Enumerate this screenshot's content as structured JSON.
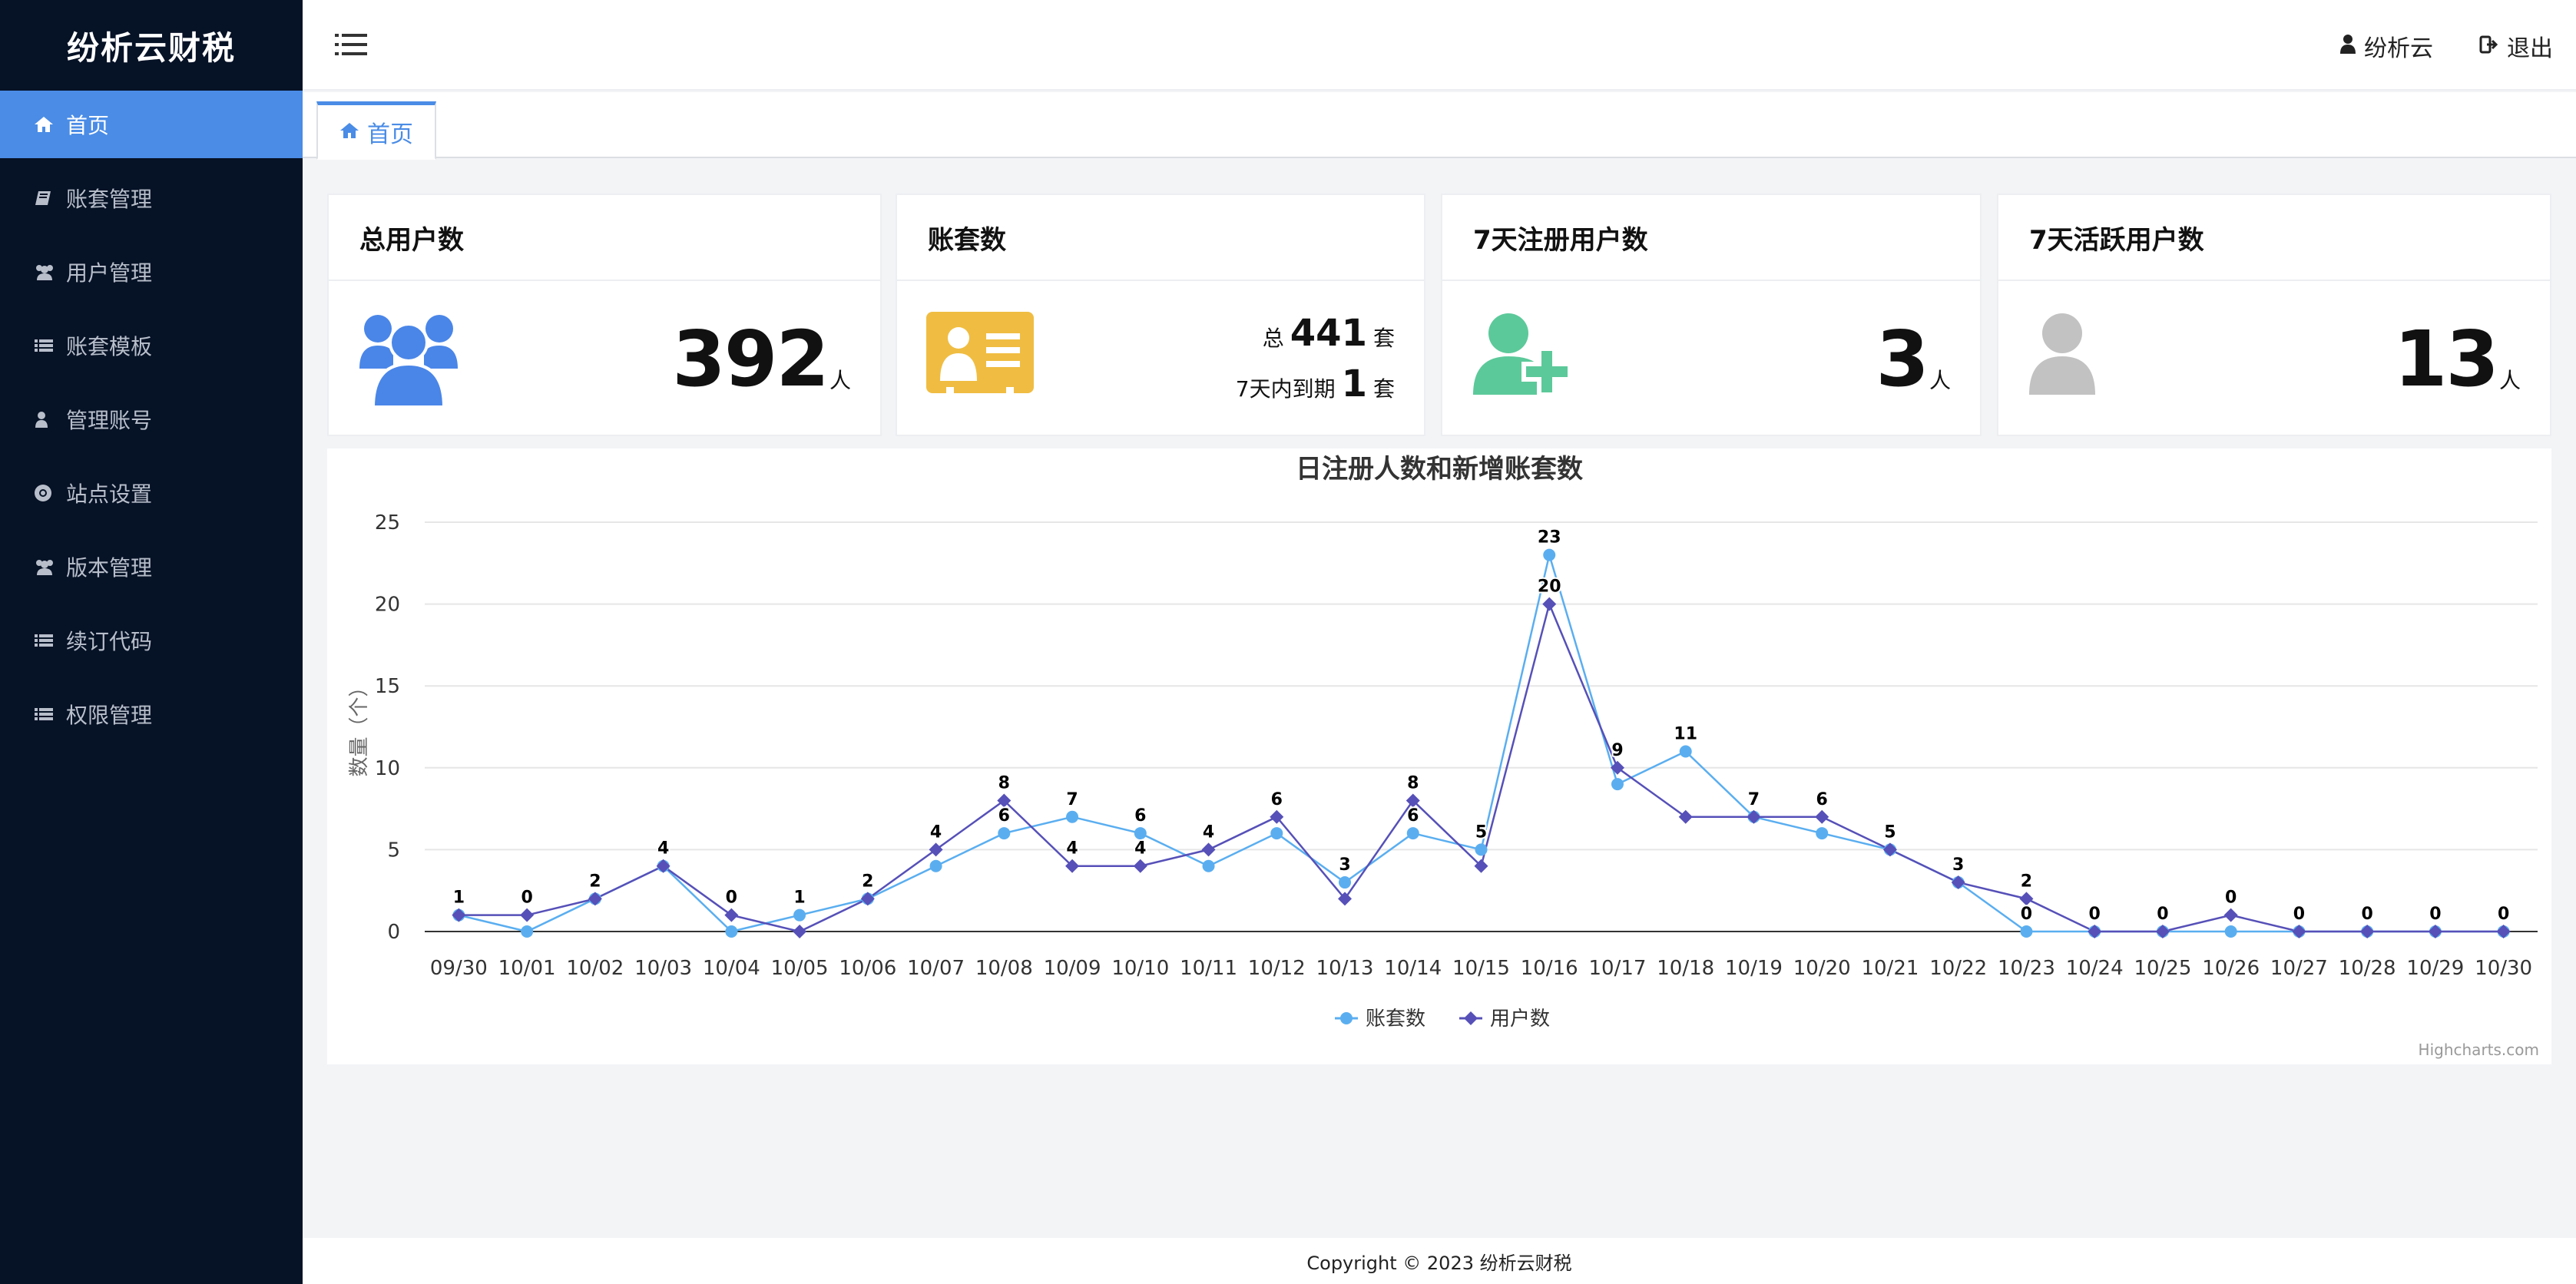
{
  "app": {
    "brand": "纷析云财税"
  },
  "sidebar": {
    "items": [
      {
        "label": "首页",
        "icon": "home-icon",
        "active": true
      },
      {
        "label": "账套管理",
        "icon": "book-icon"
      },
      {
        "label": "用户管理",
        "icon": "users-icon"
      },
      {
        "label": "账套模板",
        "icon": "list-icon"
      },
      {
        "label": "管理账号",
        "icon": "user-icon"
      },
      {
        "label": "站点设置",
        "icon": "chrome-icon"
      },
      {
        "label": "版本管理",
        "icon": "users-icon"
      },
      {
        "label": "续订代码",
        "icon": "list-icon"
      },
      {
        "label": "权限管理",
        "icon": "list-icon"
      }
    ]
  },
  "header": {
    "user_label": "纷析云",
    "logout_label": "退出"
  },
  "tabs": [
    {
      "label": "首页"
    }
  ],
  "stats": {
    "total_users": {
      "title": "总用户数",
      "value": "392",
      "unit": "人"
    },
    "accounts": {
      "title": "账套数",
      "total_prefix": "总",
      "total_value": "441",
      "total_unit": "套",
      "expire_prefix": "7天内到期",
      "expire_value": "1",
      "expire_unit": "套"
    },
    "new_users_7d": {
      "title": "7天注册用户数",
      "value": "3",
      "unit": "人"
    },
    "active_users_7d": {
      "title": "7天活跃用户数",
      "value": "13",
      "unit": "人"
    }
  },
  "chart_data": {
    "type": "line",
    "title": "日注册人数和新增账套数",
    "ylabel": "数量（个）",
    "xlabel": "",
    "ylim": [
      0,
      25
    ],
    "yticks": [
      0,
      5,
      10,
      15,
      20,
      25
    ],
    "grid": true,
    "legend_position": "bottom-center",
    "credits": "Highcharts.com",
    "categories": [
      "09/30",
      "10/01",
      "10/02",
      "10/03",
      "10/04",
      "10/05",
      "10/06",
      "10/07",
      "10/08",
      "10/09",
      "10/10",
      "10/11",
      "10/12",
      "10/13",
      "10/14",
      "10/15",
      "10/16",
      "10/17",
      "10/18",
      "10/19",
      "10/20",
      "10/21",
      "10/22",
      "10/23",
      "10/24",
      "10/25",
      "10/26",
      "10/27",
      "10/28",
      "10/29",
      "10/30"
    ],
    "series": [
      {
        "name": "账套数",
        "color": "#5aaef0",
        "marker": "circle",
        "values": [
          1,
          0,
          2,
          4,
          0,
          1,
          2,
          4,
          6,
          7,
          6,
          4,
          6,
          3,
          6,
          5,
          23,
          9,
          11,
          7,
          6,
          5,
          3,
          0,
          0,
          0,
          0,
          0,
          0,
          0,
          0
        ]
      },
      {
        "name": "用户数",
        "color": "#5650b8",
        "marker": "diamond",
        "values": [
          1,
          1,
          2,
          4,
          1,
          0,
          2,
          5,
          8,
          4,
          4,
          5,
          7,
          2,
          8,
          4,
          20,
          10,
          7,
          7,
          7,
          5,
          3,
          2,
          0,
          0,
          1,
          0,
          0,
          0,
          0
        ]
      }
    ],
    "data_labels": [
      1,
      0,
      2,
      4,
      0,
      1,
      2,
      4,
      8,
      7,
      6,
      4,
      6,
      3,
      8,
      5,
      23,
      9,
      11,
      7,
      6,
      5,
      3,
      2,
      0,
      0,
      0,
      0,
      0,
      0,
      0
    ],
    "data_labels_extra": {
      "8": 6,
      "9": 4,
      "10": 4,
      "14": 6,
      "16": 20,
      "23": 0
    }
  },
  "footer": {
    "copyright": "Copyright © 2023 纷析云财税"
  },
  "colors": {
    "sidebar_bg": "#061226",
    "accent": "#4a8ce6",
    "icon_blue": "#4a86e8",
    "icon_yellow": "#f0bd42",
    "icon_green": "#5cc99a",
    "icon_gray": "#c2c2c2"
  }
}
